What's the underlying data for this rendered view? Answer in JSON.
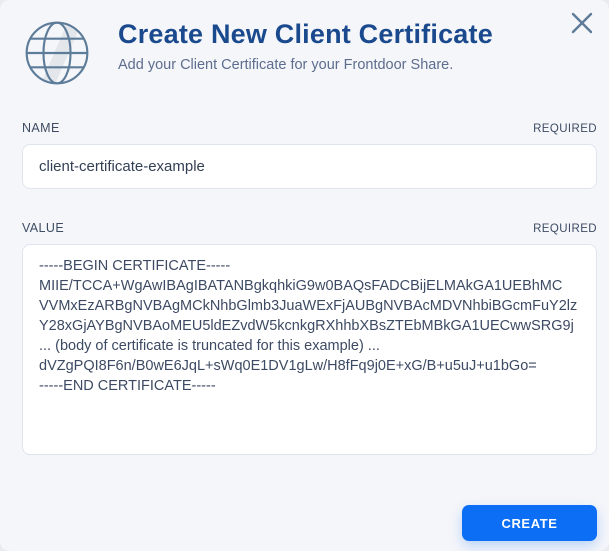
{
  "modal": {
    "title": "Create New Client Certificate",
    "subtitle": "Add your Client Certificate for your Frontdoor Share."
  },
  "fields": {
    "name": {
      "label": "NAME",
      "required_label": "REQUIRED",
      "value": "client-certificate-example"
    },
    "value": {
      "label": "VALUE",
      "required_label": "REQUIRED",
      "value": "-----BEGIN CERTIFICATE-----\nMIIE/TCCA+WgAwIBAgIBATANBgkqhkiG9w0BAQsFADCBijELMAkGA1UEBhMC\nVVMxEzARBgNVBAgMCkNhbGlmb3JuaWExFjAUBgNVBAcMDVNhbiBGcmFuY2lz\nY28xGjAYBgNVBAoMEU5ldEZvdW5kcnkgRXhhbXBsZTEbMBkGA1UECwwSRG9j\n... (body of certificate is truncated for this example) ...\ndVZgPQI8F6n/B0wE6JqL+sWq0E1DV1gLw/H8fFq9j0E+xG/B+u5uJ+u1bGo=\n-----END CERTIFICATE-----"
    }
  },
  "actions": {
    "create_label": "CREATE"
  },
  "icons": {
    "globe": "globe-icon",
    "close": "close-icon"
  },
  "colors": {
    "accent_blue": "#0c6ef5",
    "title_navy": "#1a4a8d",
    "icon_steel": "#5d7c99",
    "background": "#f5f6fa",
    "input_border": "#dfe4ee"
  }
}
